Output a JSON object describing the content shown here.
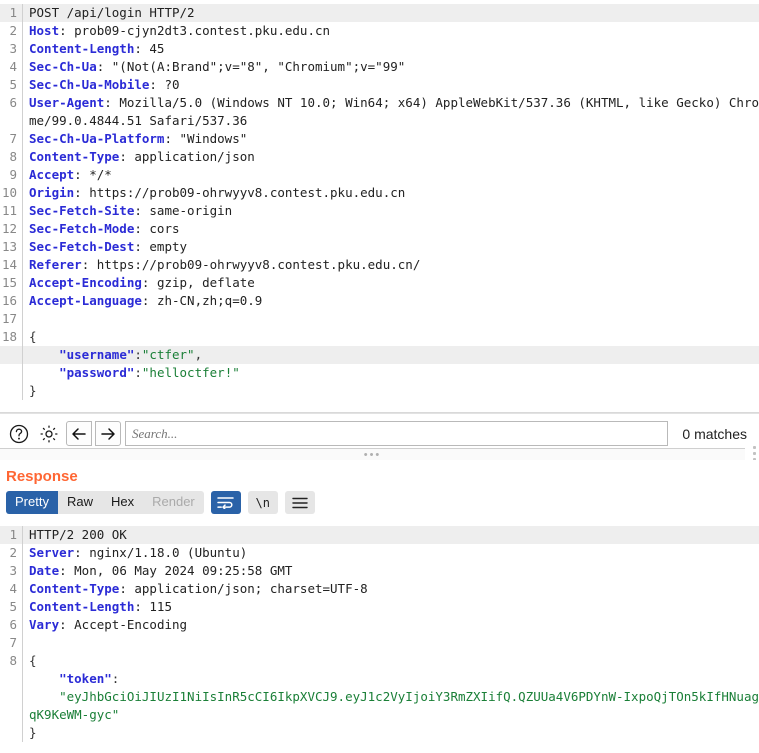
{
  "request": {
    "lines": [
      {
        "n": "1",
        "highlight": true,
        "segments": [
          {
            "t": "POST /api/login HTTP/2",
            "c": "val"
          }
        ]
      },
      {
        "n": "2",
        "highlight": false,
        "segments": [
          {
            "t": "Host",
            "c": "hdr"
          },
          {
            "t": ": prob09-cjyn2dt3.contest.pku.edu.cn",
            "c": "val"
          }
        ]
      },
      {
        "n": "3",
        "highlight": false,
        "segments": [
          {
            "t": "Content-Length",
            "c": "hdr"
          },
          {
            "t": ": 45",
            "c": "val"
          }
        ]
      },
      {
        "n": "4",
        "highlight": false,
        "segments": [
          {
            "t": "Sec-Ch-Ua",
            "c": "hdr"
          },
          {
            "t": ": \"(Not(A:Brand\";v=\"8\", \"Chromium\";v=\"99\"",
            "c": "val"
          }
        ]
      },
      {
        "n": "5",
        "highlight": false,
        "segments": [
          {
            "t": "Sec-Ch-Ua-Mobile",
            "c": "hdr"
          },
          {
            "t": ": ?0",
            "c": "val"
          }
        ]
      },
      {
        "n": "6",
        "highlight": false,
        "segments": [
          {
            "t": "User-Agent",
            "c": "hdr"
          },
          {
            "t": ": Mozilla/5.0 (Windows NT 10.0; Win64; x64) AppleWebKit/537.36 (KHTML, like Gecko) Chrome/99.0.4844.51 Safari/537.36",
            "c": "val"
          }
        ]
      },
      {
        "n": "7",
        "highlight": false,
        "segments": [
          {
            "t": "Sec-Ch-Ua-Platform",
            "c": "hdr"
          },
          {
            "t": ": \"Windows\"",
            "c": "val"
          }
        ]
      },
      {
        "n": "8",
        "highlight": false,
        "segments": [
          {
            "t": "Content-Type",
            "c": "hdr"
          },
          {
            "t": ": application/json",
            "c": "val"
          }
        ]
      },
      {
        "n": "9",
        "highlight": false,
        "segments": [
          {
            "t": "Accept",
            "c": "hdr"
          },
          {
            "t": ": */*",
            "c": "val"
          }
        ]
      },
      {
        "n": "10",
        "highlight": false,
        "segments": [
          {
            "t": "Origin",
            "c": "hdr"
          },
          {
            "t": ": https://prob09-ohrwyyv8.contest.pku.edu.cn",
            "c": "val"
          }
        ]
      },
      {
        "n": "11",
        "highlight": false,
        "segments": [
          {
            "t": "Sec-Fetch-Site",
            "c": "hdr"
          },
          {
            "t": ": same-origin",
            "c": "val"
          }
        ]
      },
      {
        "n": "12",
        "highlight": false,
        "segments": [
          {
            "t": "Sec-Fetch-Mode",
            "c": "hdr"
          },
          {
            "t": ": cors",
            "c": "val"
          }
        ]
      },
      {
        "n": "13",
        "highlight": false,
        "segments": [
          {
            "t": "Sec-Fetch-Dest",
            "c": "hdr"
          },
          {
            "t": ": empty",
            "c": "val"
          }
        ]
      },
      {
        "n": "14",
        "highlight": false,
        "segments": [
          {
            "t": "Referer",
            "c": "hdr"
          },
          {
            "t": ": https://prob09-ohrwyyv8.contest.pku.edu.cn/",
            "c": "val"
          }
        ]
      },
      {
        "n": "15",
        "highlight": false,
        "segments": [
          {
            "t": "Accept-Encoding",
            "c": "hdr"
          },
          {
            "t": ": gzip, deflate",
            "c": "val"
          }
        ]
      },
      {
        "n": "16",
        "highlight": false,
        "segments": [
          {
            "t": "Accept-Language",
            "c": "hdr"
          },
          {
            "t": ": zh-CN,zh;q=0.9",
            "c": "val"
          }
        ]
      },
      {
        "n": "17",
        "highlight": false,
        "segments": [
          {
            "t": "",
            "c": "val"
          }
        ]
      },
      {
        "n": "18",
        "highlight": false,
        "segments": [
          {
            "t": "{",
            "c": "punc"
          }
        ]
      },
      {
        "n": "",
        "highlight": true,
        "segments": [
          {
            "t": "    ",
            "c": "punc"
          },
          {
            "t": "\"username\"",
            "c": "key"
          },
          {
            "t": ":",
            "c": "punc"
          },
          {
            "t": "\"ctfer\"",
            "c": "str"
          },
          {
            "t": ",",
            "c": "punc"
          }
        ]
      },
      {
        "n": "",
        "highlight": false,
        "segments": [
          {
            "t": "    ",
            "c": "punc"
          },
          {
            "t": "\"password\"",
            "c": "key"
          },
          {
            "t": ":",
            "c": "punc"
          },
          {
            "t": "\"helloctfer!\"",
            "c": "str"
          }
        ]
      },
      {
        "n": "",
        "highlight": false,
        "segments": [
          {
            "t": "}",
            "c": "punc"
          }
        ]
      }
    ]
  },
  "searchbar": {
    "help_icon": "question-circle-icon",
    "settings_icon": "gear-icon",
    "prev_label": "←",
    "next_label": "→",
    "placeholder": "Search...",
    "value": "",
    "matches": "0 matches"
  },
  "response": {
    "title": "Response",
    "tabs": [
      {
        "label": "Pretty",
        "state": "active"
      },
      {
        "label": "Raw",
        "state": "normal"
      },
      {
        "label": "Hex",
        "state": "normal"
      },
      {
        "label": "Render",
        "state": "disabled"
      }
    ],
    "tools": [
      {
        "label": "↵",
        "name": "word-wrap-button",
        "state": "on"
      },
      {
        "label": "\\n",
        "name": "newline-escape-button",
        "state": "off"
      },
      {
        "label": "≡",
        "name": "menu-button",
        "state": "off"
      }
    ],
    "lines": [
      {
        "n": "1",
        "highlight": true,
        "segments": [
          {
            "t": "HTTP/2 200 OK",
            "c": "val"
          }
        ]
      },
      {
        "n": "2",
        "highlight": false,
        "segments": [
          {
            "t": "Server",
            "c": "hdr"
          },
          {
            "t": ": nginx/1.18.0 (Ubuntu)",
            "c": "val"
          }
        ]
      },
      {
        "n": "3",
        "highlight": false,
        "segments": [
          {
            "t": "Date",
            "c": "hdr"
          },
          {
            "t": ": Mon, 06 May 2024 09:25:58 GMT",
            "c": "val"
          }
        ]
      },
      {
        "n": "4",
        "highlight": false,
        "segments": [
          {
            "t": "Content-Type",
            "c": "hdr"
          },
          {
            "t": ": application/json; charset=UTF-8",
            "c": "val"
          }
        ]
      },
      {
        "n": "5",
        "highlight": false,
        "segments": [
          {
            "t": "Content-Length",
            "c": "hdr"
          },
          {
            "t": ": 115",
            "c": "val"
          }
        ]
      },
      {
        "n": "6",
        "highlight": false,
        "segments": [
          {
            "t": "Vary",
            "c": "hdr"
          },
          {
            "t": ": Accept-Encoding",
            "c": "val"
          }
        ]
      },
      {
        "n": "7",
        "highlight": false,
        "segments": [
          {
            "t": "",
            "c": "val"
          }
        ]
      },
      {
        "n": "8",
        "highlight": false,
        "segments": [
          {
            "t": "{",
            "c": "punc"
          }
        ]
      },
      {
        "n": "",
        "highlight": false,
        "segments": [
          {
            "t": "    ",
            "c": "punc"
          },
          {
            "t": "\"token\"",
            "c": "key"
          },
          {
            "t": ":",
            "c": "punc"
          }
        ]
      },
      {
        "n": "",
        "highlight": false,
        "segments": [
          {
            "t": "    ",
            "c": "punc"
          },
          {
            "t": "\"eyJhbGciOiJIUzI1NiIsInR5cCI6IkpXVCJ9.eyJ1c2VyIjoiY3RmZXIifQ.QZUUa4V6PDYnW-IxpoQjTOn5kIfHNuagqK9KeWM-gyc\"",
            "c": "str"
          }
        ]
      },
      {
        "n": "",
        "highlight": false,
        "segments": [
          {
            "t": "}",
            "c": "punc"
          }
        ]
      }
    ]
  }
}
